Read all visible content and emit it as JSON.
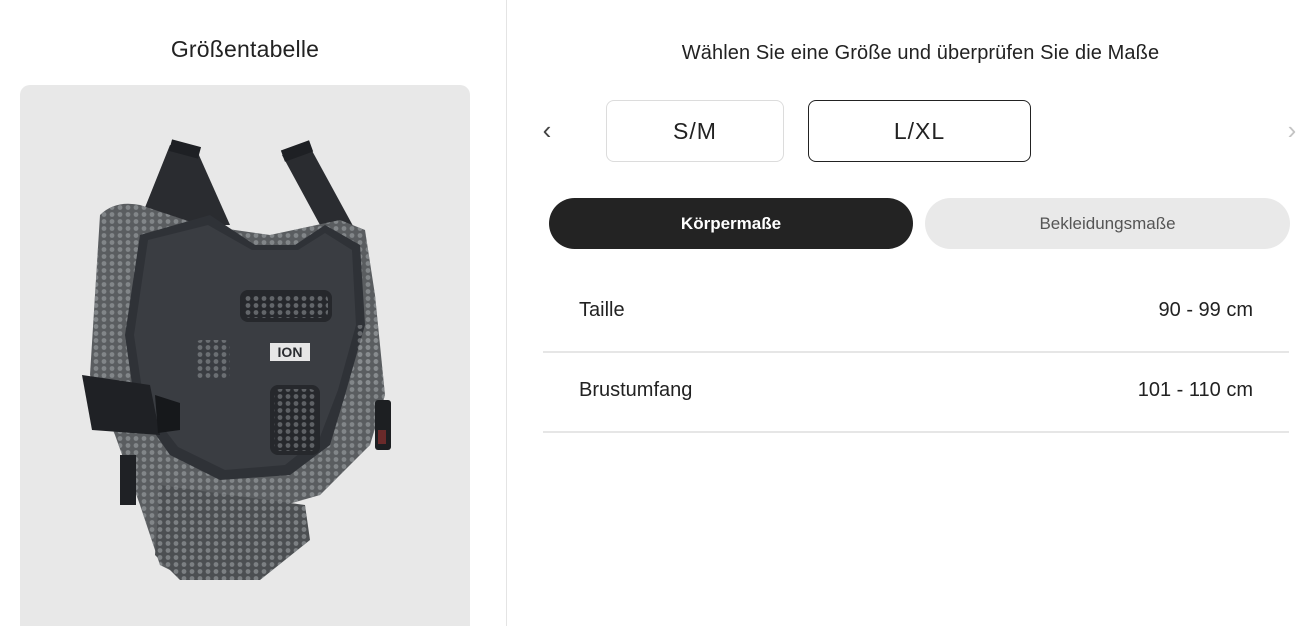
{
  "left": {
    "title": "Größentabelle",
    "product_image": "body-protector-vest",
    "logo_text": "ION"
  },
  "right": {
    "title": "Wählen Sie eine Größe und überprüfen Sie die Maße",
    "nav": {
      "prev_icon": "chevron-left-icon",
      "next_icon": "chevron-right-icon"
    },
    "sizes": [
      {
        "label": "S/M",
        "selected": false
      },
      {
        "label": "L/XL",
        "selected": true
      }
    ],
    "tabs": [
      {
        "label": "Körpermaße",
        "active": true
      },
      {
        "label": "Bekleidungsmaße",
        "active": false
      }
    ],
    "measurements": [
      {
        "label": "Taille",
        "value": "90 - 99 cm"
      },
      {
        "label": "Brustumfang",
        "value": "101 - 110 cm"
      }
    ]
  },
  "colors": {
    "active_tab_bg": "#232323",
    "inactive_tab_bg": "#e9e9e9",
    "image_card_bg": "#e8e8e8",
    "selected_size_border": "#222222"
  }
}
